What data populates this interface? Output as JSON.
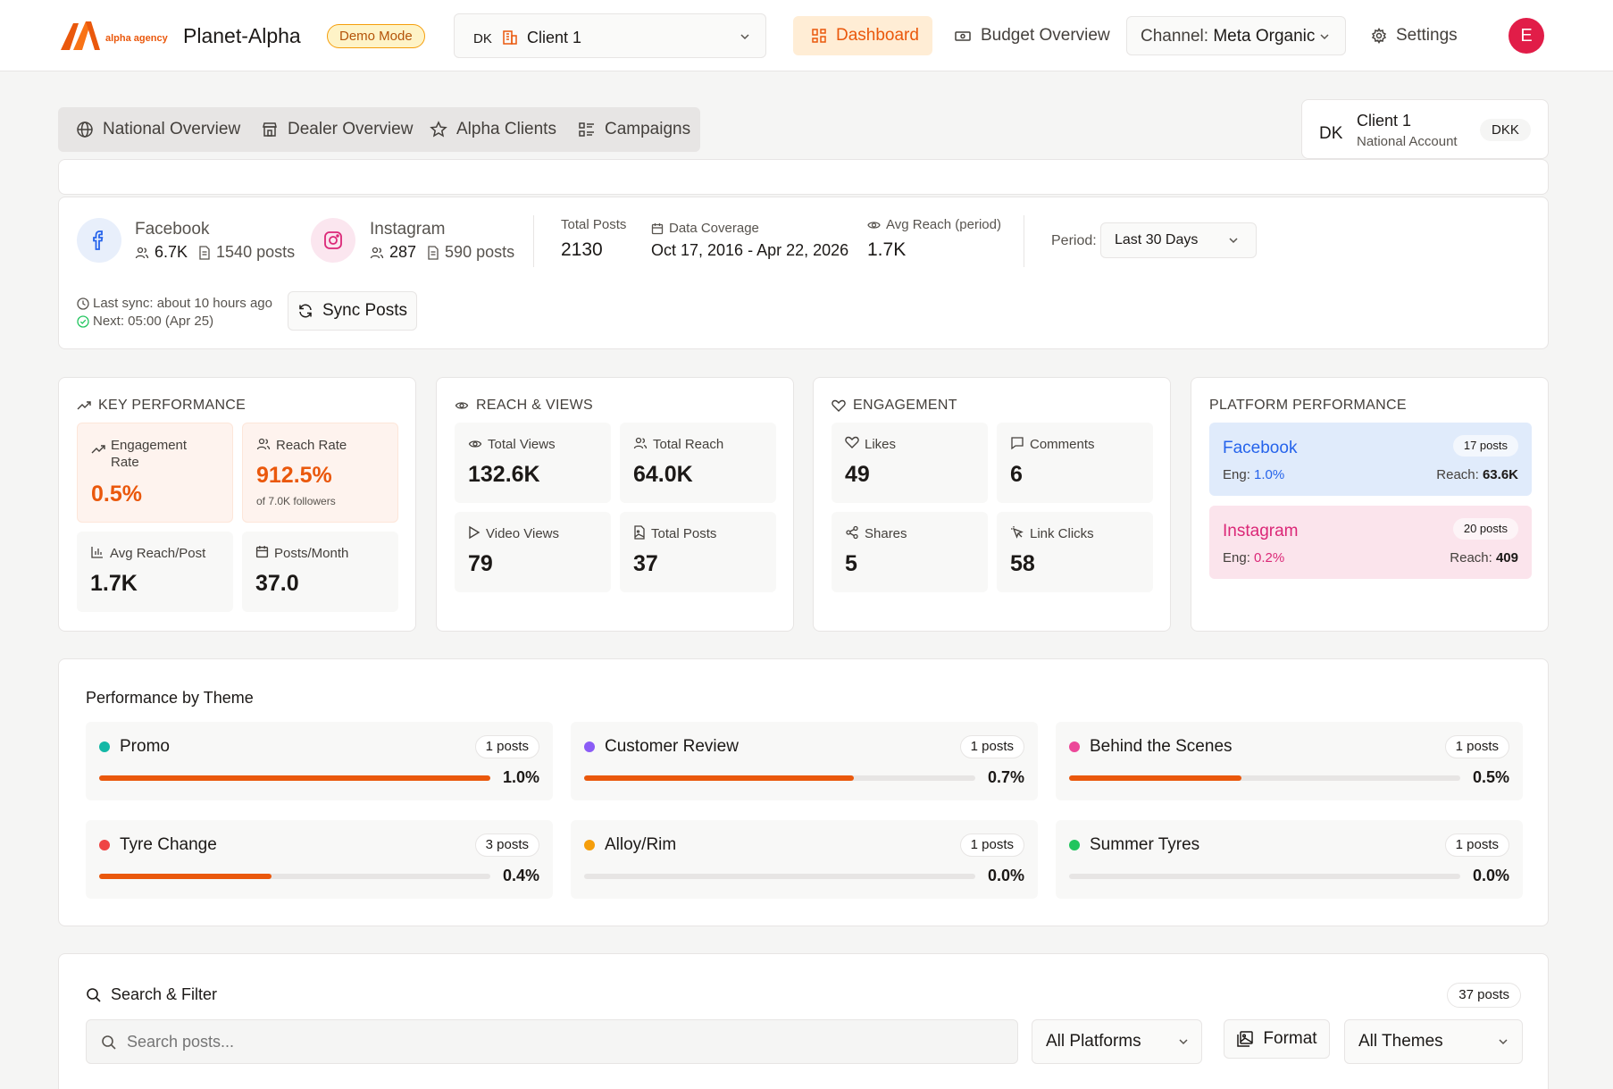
{
  "header": {
    "logo_text": "alpha agency",
    "app_title": "Planet-Alpha",
    "demo_badge": "Demo Mode",
    "client_select": {
      "country": "DK",
      "name": "Client 1"
    },
    "nav": {
      "dashboard": "Dashboard",
      "budget": "Budget Overview",
      "settings": "Settings"
    },
    "channel": {
      "label": "Channel:",
      "value": "Meta Organic"
    },
    "avatar_initial": "E",
    "accent_color": "#ea580c"
  },
  "tabs": [
    {
      "label": "National Overview",
      "icon": "globe-icon"
    },
    {
      "label": "Dealer Overview",
      "icon": "store-icon"
    },
    {
      "label": "Alpha Clients",
      "icon": "star-icon"
    },
    {
      "label": "Campaigns",
      "icon": "list-icon"
    }
  ],
  "account": {
    "country": "DK",
    "name": "Client 1",
    "type": "National Account",
    "currency": "DKK"
  },
  "overview": {
    "facebook": {
      "name": "Facebook",
      "followers": "6.7K",
      "posts": "1540 posts"
    },
    "instagram": {
      "name": "Instagram",
      "followers": "287",
      "posts": "590 posts"
    },
    "total_posts": {
      "label": "Total Posts",
      "value": "2130"
    },
    "coverage": {
      "label": "Data Coverage",
      "value": "Oct 17, 2016 - Apr 22, 2026"
    },
    "avg_reach": {
      "label": "Avg Reach (period)",
      "value": "1.7K"
    },
    "period": {
      "label": "Period:",
      "value": "Last 30 Days"
    },
    "last_sync": "Last sync: about 10 hours ago",
    "next_sync": "Next: 05:00 (Apr 25)",
    "sync_button": "Sync Posts"
  },
  "key_performance": {
    "title": "KEY PERFORMANCE",
    "engagement_rate": {
      "label": "Engagement Rate",
      "value": "0.5%"
    },
    "reach_rate": {
      "label": "Reach Rate",
      "value": "912.5%",
      "note": "of 7.0K followers"
    },
    "avg_reach_post": {
      "label": "Avg Reach/Post",
      "value": "1.7K"
    },
    "posts_month": {
      "label": "Posts/Month",
      "value": "37.0"
    }
  },
  "reach_views": {
    "title": "REACH & VIEWS",
    "total_views": {
      "label": "Total Views",
      "value": "132.6K"
    },
    "total_reach": {
      "label": "Total Reach",
      "value": "64.0K"
    },
    "video_views": {
      "label": "Video Views",
      "value": "79"
    },
    "total_posts": {
      "label": "Total Posts",
      "value": "37"
    }
  },
  "engagement": {
    "title": "ENGAGEMENT",
    "likes": {
      "label": "Likes",
      "value": "49"
    },
    "comments": {
      "label": "Comments",
      "value": "6"
    },
    "shares": {
      "label": "Shares",
      "value": "5"
    },
    "link_clicks": {
      "label": "Link Clicks",
      "value": "58"
    }
  },
  "platform_performance": {
    "title": "PLATFORM PERFORMANCE",
    "facebook": {
      "name": "Facebook",
      "posts": "17 posts",
      "eng_label": "Eng:",
      "eng": "1.0%",
      "reach_label": "Reach:",
      "reach": "63.6K",
      "color": "#2563eb",
      "bg": "#e0ebfb"
    },
    "instagram": {
      "name": "Instagram",
      "posts": "20 posts",
      "eng_label": "Eng:",
      "eng": "0.2%",
      "reach_label": "Reach:",
      "reach": "409",
      "color": "#db2777",
      "bg": "#fbe4ec"
    }
  },
  "themes": {
    "title": "Performance by Theme",
    "items": [
      {
        "name": "Promo",
        "posts": "1 posts",
        "pct": "1.0%",
        "fill": 1.0,
        "color": "#14b8a6"
      },
      {
        "name": "Customer Review",
        "posts": "1 posts",
        "pct": "0.7%",
        "fill": 0.69,
        "color": "#8b5cf6"
      },
      {
        "name": "Behind the Scenes",
        "posts": "1 posts",
        "pct": "0.5%",
        "fill": 0.44,
        "color": "#ec4899"
      },
      {
        "name": "Tyre Change",
        "posts": "3 posts",
        "pct": "0.4%",
        "fill": 0.44,
        "color": "#ef4444"
      },
      {
        "name": "Alloy/Rim",
        "posts": "1 posts",
        "pct": "0.0%",
        "fill": 0.0,
        "color": "#f59e0b"
      },
      {
        "name": "Summer Tyres",
        "posts": "1 posts",
        "pct": "0.0%",
        "fill": 0.0,
        "color": "#22c55e"
      }
    ]
  },
  "search": {
    "title": "Search & Filter",
    "count": "37 posts",
    "placeholder": "Search posts...",
    "platforms": "All Platforms",
    "format": "Format",
    "themes": "All Themes"
  }
}
